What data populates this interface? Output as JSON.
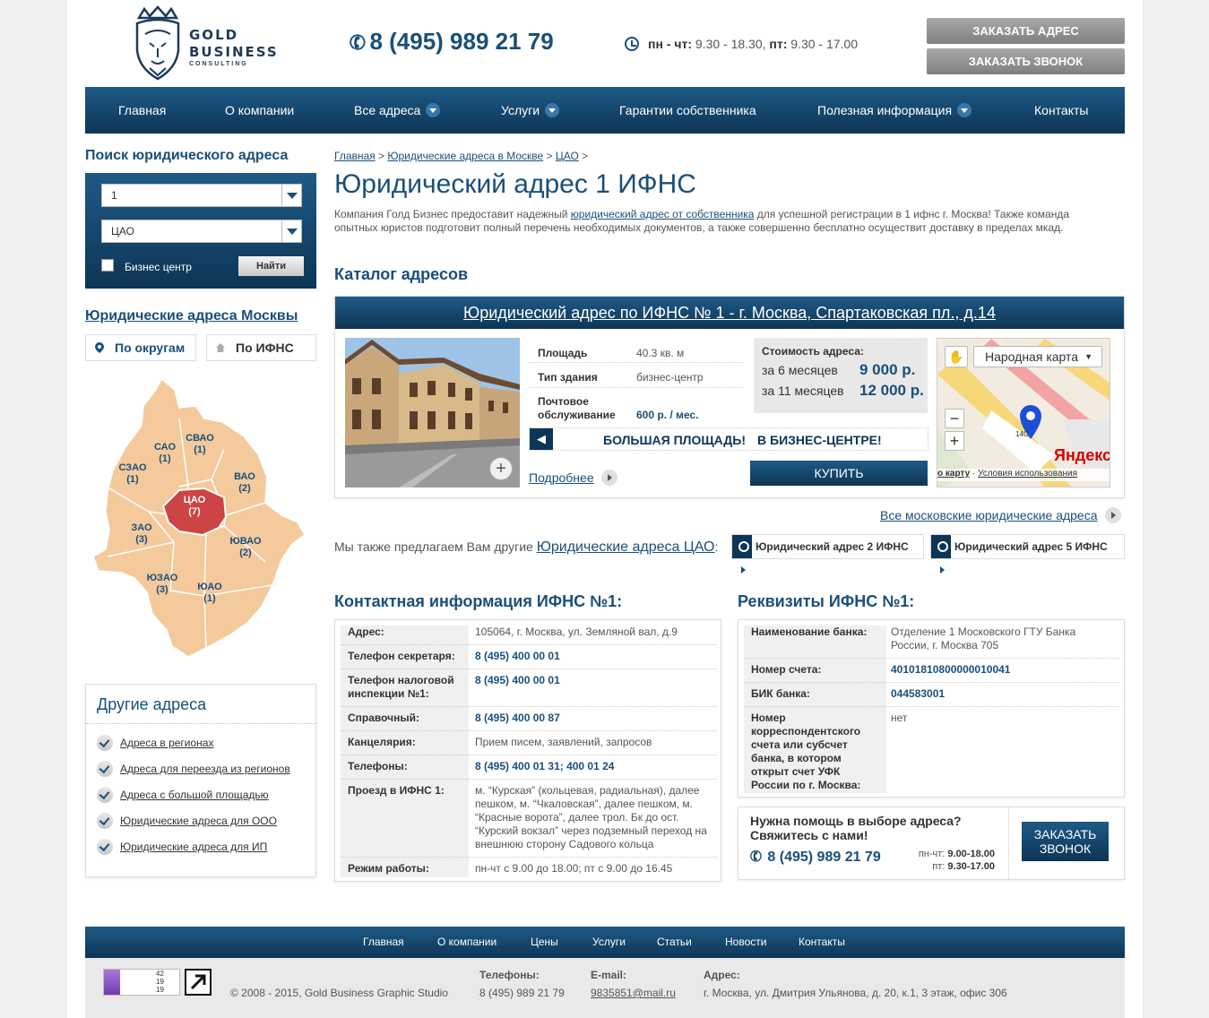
{
  "header": {
    "logo_line1": "GOLD",
    "logo_line2": "BUSINESS",
    "logo_line3": "CONSULTING",
    "phone": "8 (495) 989 21 79",
    "hours_label1": "пн - чт:",
    "hours_value1": " 9.30 - 18.30, ",
    "hours_label2": "пт:",
    "hours_value2": " 9.30 - 17.00",
    "btn_order_address": "Заказать адрес",
    "btn_order_call": "Заказать звонок"
  },
  "nav": {
    "items": [
      {
        "label": "Главная"
      },
      {
        "label": "О компании"
      },
      {
        "label": "Все адреса"
      },
      {
        "label": "Услуги"
      },
      {
        "label": "Гарантии собственника"
      },
      {
        "label": "Полезная информация"
      },
      {
        "label": "Контакты"
      }
    ]
  },
  "sidebar": {
    "search_title": "Поиск юридического адреса",
    "select1_value": "1",
    "select2_value": "ЦАО",
    "checkbox_label": "Бизнес центр",
    "find_button": "Найти",
    "map_title": "Юридические адреса Москвы",
    "tab_districts": "По округам",
    "tab_ifns": "По ИФНС",
    "districts": [
      {
        "name": "САО",
        "count": "(1)"
      },
      {
        "name": "СВАО",
        "count": "(1)"
      },
      {
        "name": "СЗАО",
        "count": "(1)"
      },
      {
        "name": "ВАО",
        "count": "(2)"
      },
      {
        "name": "ЦАО",
        "count": "(7)"
      },
      {
        "name": "ЗАО",
        "count": "(3)"
      },
      {
        "name": "ЮВАО",
        "count": "(2)"
      },
      {
        "name": "ЮЗАО",
        "count": "(3)"
      },
      {
        "name": "ЮАО",
        "count": "(1)"
      }
    ],
    "other_title": "Другие адреса",
    "other_items": [
      "Адреса в регионах",
      "Адреса для переезда из регионов",
      "Адреса с большой площадью",
      "Юридические адреса для ООО",
      "Юридические адреса для ИП"
    ]
  },
  "main": {
    "breadcrumb": {
      "home": "Главная",
      "sep": " > ",
      "level2": "Юридические адреса в Москве",
      "level3": "ЦАО",
      "tail": " >"
    },
    "title": "Юридический адрес 1 ИФНС",
    "intro_before": "Компания Голд Бизнес предоставит надежный ",
    "intro_link": "юридический адрес от собственника",
    "intro_after": " для успешной регистрации в 1 ифнс г. Москва! Также команда опытных юристов подготовит полный перечень необходимых документов, а также совершенно бесплатно осуществит доставку в пределах мкад.",
    "catalog_title": "Каталог адресов",
    "card": {
      "title": "Юридический адрес по ИФНС № 1 - г. Москва, Спартаковская пл., д.14",
      "area_label": "Площадь",
      "area_value": "40.3 кв. м",
      "type_label": "Тип здания",
      "type_value": "бизнес-центр",
      "mail_label": "Почтовое обслуживание",
      "mail_value": "600 р. / мес.",
      "price_title": "Стоимость адреса:",
      "price_6_label": "за 6 месяцев",
      "price_6_value": "9 000 р.",
      "price_11_label": "за 11 месяцев",
      "price_11_value": "12 000 р.",
      "promo1": "БОЛЬШАЯ ПЛОЩАДЬ!",
      "promo2": "В БИЗНЕС-ЦЕНТРЕ!",
      "more_link": "Подробнее",
      "buy_button": "КУПИТЬ",
      "map_layer": "Народная карта",
      "map_brand": "Яндекс",
      "map_footer_left": "о карту",
      "map_footer_right": "Условия использования",
      "map_house": "14С"
    },
    "all_addresses_link": "Все московские юридические адреса",
    "offer_text": "Мы также предлагаем Вам другие ",
    "offer_link": "Юридические адреса ЦАО",
    "offer_colon": ":",
    "chip1": "Юридический адрес 2 ИФНС",
    "chip2": "Юридический адрес 5 ИФНС",
    "contacts_title": "Контактная информация ИФНС №1:",
    "contacts": [
      {
        "k": "Адрес:",
        "v": "105064, г. Москва, ул. Земляной вал, д.9"
      },
      {
        "k": "Телефон секретаря:",
        "v": "8 (495) 400 00 01"
      },
      {
        "k": "Телефон налоговой инспекции №1:",
        "v": "8 (495) 400 00 01"
      },
      {
        "k": "Справочный:",
        "v": "8 (495) 400 00 87"
      },
      {
        "k": "Канцелярия:",
        "v": "Прием писем, заявлений, запросов"
      },
      {
        "k": "Телефоны:",
        "v": "8 (495) 400 01 31; 400 01 24"
      },
      {
        "k": "Проезд в ИФНС 1:",
        "v": "м. “Курская” (кольцевая, радиальная), далее пешком, м. “Чкаловская”, далее пешком, м. “Красные ворота”, далее трол. Бк до ост. “Курский вокзал” через подземный переход на внешнюю сторону Садового кольца"
      },
      {
        "k": "Режим работы:",
        "v": "пн-чт с 9.00 до 18.00; пт с 9.00 до 16.45"
      }
    ],
    "requisites_title": "Реквизиты ИФНС №1:",
    "requisites": [
      {
        "k": "Наименование банка:",
        "v": "Отделение 1 Московского ГТУ Банка России, г. Москва 705"
      },
      {
        "k": "Номер счета:",
        "v": "40101810800000010041"
      },
      {
        "k": "БИК банка:",
        "v": "044583001"
      },
      {
        "k": "Номер корреспондентского счета или субсчет банка, в котором открыт счет УФК России по г. Москва:",
        "v": "нет"
      }
    ],
    "help": {
      "question": "Нужна помощь в выборе адреса?",
      "contact_us": "Свяжитесь с нами!",
      "phone": "8 (495) 989 21 79",
      "hours1_label": "пн-чт: ",
      "hours1_value": "9.00-18.00",
      "hours2_label": "пт: ",
      "hours2_value": "9.30-17.00",
      "button_line1": "ЗАКАЗАТЬ",
      "button_line2": "ЗВОНОК"
    }
  },
  "footer": {
    "nav": [
      "Главная",
      "О компании",
      "Цены",
      "Услуги",
      "Статьи",
      "Новости",
      "Контакты"
    ],
    "counter_values": [
      "42",
      "19",
      "19"
    ],
    "copyright": "© 2008 - 2015, Gold Business Graphic Studio",
    "phones_label": "Телефоны:",
    "phones_value": "8 (495) 989 21 79",
    "email_label": "E-mail:",
    "email_value": "9835851@mail.ru",
    "address_label": "Адрес:",
    "address_value": "г. Москва, ул. Дмитрия Ульянова, д. 20, к.1, 3 этаж, офис 306"
  },
  "colors": {
    "brand_blue": "#1a4f7a",
    "nav_dark": "#0d3556",
    "map_district": "#f4c99c",
    "map_selected": "#cc4444"
  }
}
